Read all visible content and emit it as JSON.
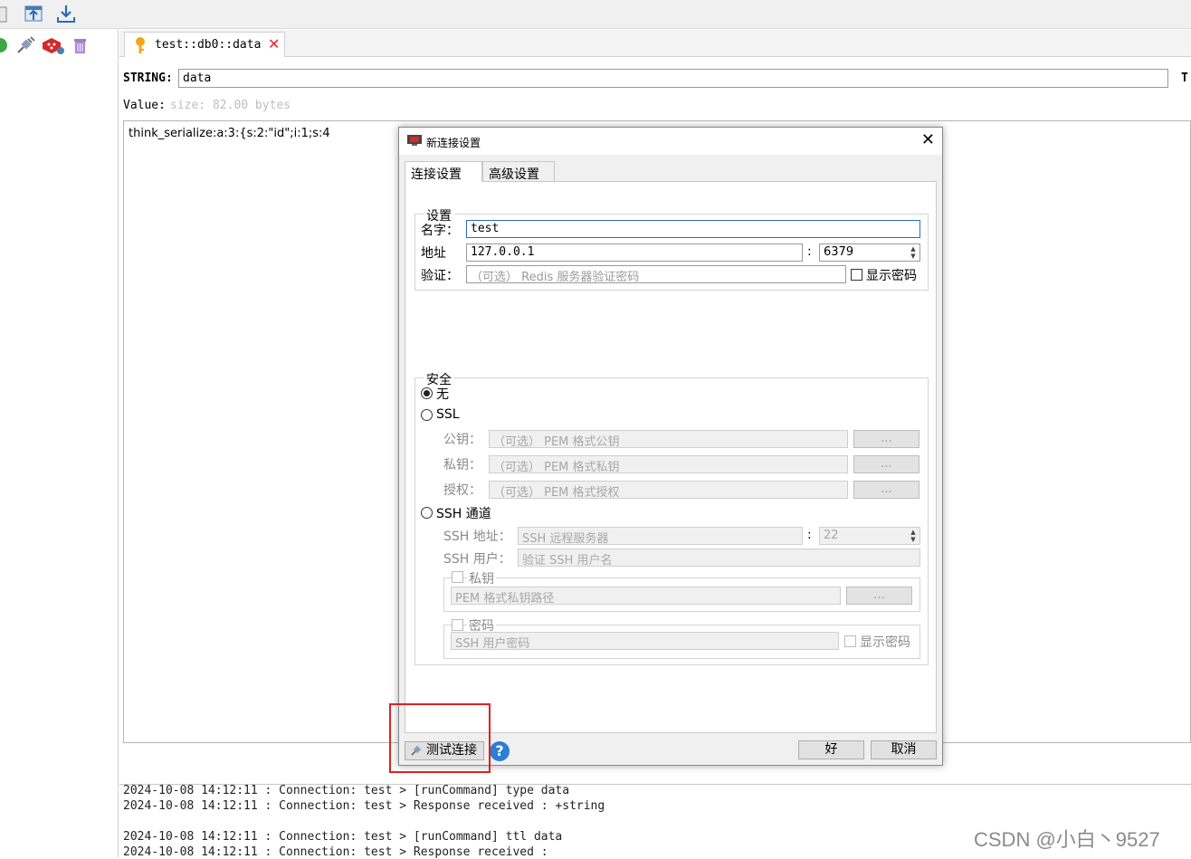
{
  "key_tab": {
    "label": "test::db0::data"
  },
  "key_editor": {
    "type_label": "STRING:",
    "key_value": "data",
    "ttl_cut": "T",
    "value_label": "Value:",
    "size_text": "size: 82.00 bytes",
    "value_text": "think_serialize:a:3:{s:2:\"id\";i:1;s:4"
  },
  "log": {
    "lines": [
      "2024-10-08 14:12:11 : Connection: test > [runCommand] type data",
      "2024-10-08 14:12:11 : Connection: test > Response received : +string",
      "",
      "2024-10-08 14:12:11 : Connection: test > [runCommand] ttl data",
      "2024-10-08 14:12:11 : Connection: test > Response received :"
    ]
  },
  "watermark": "CSDN @小白丶9527",
  "dialog": {
    "title": "新连接设置",
    "tabs": [
      "连接设置",
      "高级设置"
    ],
    "settings": {
      "group_title": "设置",
      "name_label": "名字：",
      "name_value": "test",
      "address_label": "地址",
      "host_value": "127.0.0.1",
      "port_sep": ":",
      "port_value": "6379",
      "auth_label": "验证：",
      "auth_placeholder": "（可选） Redis 服务器验证密码",
      "show_password": "显示密码"
    },
    "security": {
      "group_title": "安全",
      "none_label": "无",
      "ssl_label": "SSL",
      "pubkey_label": "公钥：",
      "pubkey_placeholder": "（可选） PEM 格式公钥",
      "privkey_label": "私钥：",
      "privkey_placeholder": "（可选） PEM 格式私钥",
      "auth_label": "授权：",
      "auth_placeholder": "（可选） PEM 格式授权",
      "browse": "...",
      "ssh_label": "SSH 通道",
      "ssh_addr_label": "SSH 地址：",
      "ssh_addr_placeholder": "SSH 远程服务器",
      "ssh_port_value": "22",
      "ssh_user_label": "SSH 用户：",
      "ssh_user_placeholder": "验证 SSH 用户名",
      "ssh_privkey_group": "私钥",
      "ssh_privkey_placeholder": "PEM 格式私钥路径",
      "ssh_password_group": "密码",
      "ssh_password_placeholder": "SSH 用户密码",
      "ssh_show_password": "显示密码"
    },
    "footer": {
      "test_button": "测试连接",
      "help": "?",
      "ok_button": "好",
      "cancel_button": "取消"
    }
  }
}
